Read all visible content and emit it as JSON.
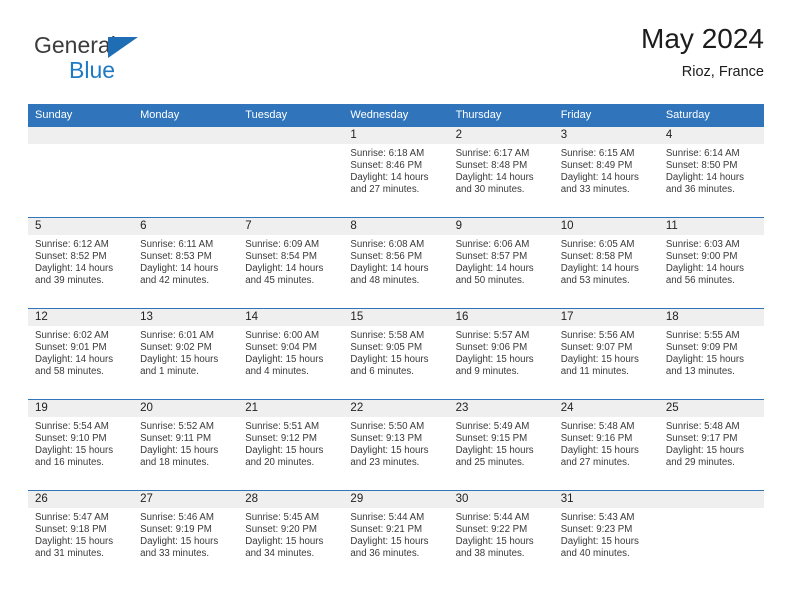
{
  "brand": {
    "name_part1": "General",
    "name_part2": "Blue",
    "accent_color": "#1f7ac4",
    "header_color": "#3075bc"
  },
  "header": {
    "title": "May 2024",
    "subtitle": "Rioz, France"
  },
  "weekday_headers": [
    "Sunday",
    "Monday",
    "Tuesday",
    "Wednesday",
    "Thursday",
    "Friday",
    "Saturday"
  ],
  "weeks": [
    [
      {
        "day": "",
        "sunrise": "",
        "sunset": "",
        "daylight_line1": "",
        "daylight_line2": ""
      },
      {
        "day": "",
        "sunrise": "",
        "sunset": "",
        "daylight_line1": "",
        "daylight_line2": ""
      },
      {
        "day": "",
        "sunrise": "",
        "sunset": "",
        "daylight_line1": "",
        "daylight_line2": ""
      },
      {
        "day": "1",
        "sunrise": "Sunrise: 6:18 AM",
        "sunset": "Sunset: 8:46 PM",
        "daylight_line1": "Daylight: 14 hours",
        "daylight_line2": "and 27 minutes."
      },
      {
        "day": "2",
        "sunrise": "Sunrise: 6:17 AM",
        "sunset": "Sunset: 8:48 PM",
        "daylight_line1": "Daylight: 14 hours",
        "daylight_line2": "and 30 minutes."
      },
      {
        "day": "3",
        "sunrise": "Sunrise: 6:15 AM",
        "sunset": "Sunset: 8:49 PM",
        "daylight_line1": "Daylight: 14 hours",
        "daylight_line2": "and 33 minutes."
      },
      {
        "day": "4",
        "sunrise": "Sunrise: 6:14 AM",
        "sunset": "Sunset: 8:50 PM",
        "daylight_line1": "Daylight: 14 hours",
        "daylight_line2": "and 36 minutes."
      }
    ],
    [
      {
        "day": "5",
        "sunrise": "Sunrise: 6:12 AM",
        "sunset": "Sunset: 8:52 PM",
        "daylight_line1": "Daylight: 14 hours",
        "daylight_line2": "and 39 minutes."
      },
      {
        "day": "6",
        "sunrise": "Sunrise: 6:11 AM",
        "sunset": "Sunset: 8:53 PM",
        "daylight_line1": "Daylight: 14 hours",
        "daylight_line2": "and 42 minutes."
      },
      {
        "day": "7",
        "sunrise": "Sunrise: 6:09 AM",
        "sunset": "Sunset: 8:54 PM",
        "daylight_line1": "Daylight: 14 hours",
        "daylight_line2": "and 45 minutes."
      },
      {
        "day": "8",
        "sunrise": "Sunrise: 6:08 AM",
        "sunset": "Sunset: 8:56 PM",
        "daylight_line1": "Daylight: 14 hours",
        "daylight_line2": "and 48 minutes."
      },
      {
        "day": "9",
        "sunrise": "Sunrise: 6:06 AM",
        "sunset": "Sunset: 8:57 PM",
        "daylight_line1": "Daylight: 14 hours",
        "daylight_line2": "and 50 minutes."
      },
      {
        "day": "10",
        "sunrise": "Sunrise: 6:05 AM",
        "sunset": "Sunset: 8:58 PM",
        "daylight_line1": "Daylight: 14 hours",
        "daylight_line2": "and 53 minutes."
      },
      {
        "day": "11",
        "sunrise": "Sunrise: 6:03 AM",
        "sunset": "Sunset: 9:00 PM",
        "daylight_line1": "Daylight: 14 hours",
        "daylight_line2": "and 56 minutes."
      }
    ],
    [
      {
        "day": "12",
        "sunrise": "Sunrise: 6:02 AM",
        "sunset": "Sunset: 9:01 PM",
        "daylight_line1": "Daylight: 14 hours",
        "daylight_line2": "and 58 minutes."
      },
      {
        "day": "13",
        "sunrise": "Sunrise: 6:01 AM",
        "sunset": "Sunset: 9:02 PM",
        "daylight_line1": "Daylight: 15 hours",
        "daylight_line2": "and 1 minute."
      },
      {
        "day": "14",
        "sunrise": "Sunrise: 6:00 AM",
        "sunset": "Sunset: 9:04 PM",
        "daylight_line1": "Daylight: 15 hours",
        "daylight_line2": "and 4 minutes."
      },
      {
        "day": "15",
        "sunrise": "Sunrise: 5:58 AM",
        "sunset": "Sunset: 9:05 PM",
        "daylight_line1": "Daylight: 15 hours",
        "daylight_line2": "and 6 minutes."
      },
      {
        "day": "16",
        "sunrise": "Sunrise: 5:57 AM",
        "sunset": "Sunset: 9:06 PM",
        "daylight_line1": "Daylight: 15 hours",
        "daylight_line2": "and 9 minutes."
      },
      {
        "day": "17",
        "sunrise": "Sunrise: 5:56 AM",
        "sunset": "Sunset: 9:07 PM",
        "daylight_line1": "Daylight: 15 hours",
        "daylight_line2": "and 11 minutes."
      },
      {
        "day": "18",
        "sunrise": "Sunrise: 5:55 AM",
        "sunset": "Sunset: 9:09 PM",
        "daylight_line1": "Daylight: 15 hours",
        "daylight_line2": "and 13 minutes."
      }
    ],
    [
      {
        "day": "19",
        "sunrise": "Sunrise: 5:54 AM",
        "sunset": "Sunset: 9:10 PM",
        "daylight_line1": "Daylight: 15 hours",
        "daylight_line2": "and 16 minutes."
      },
      {
        "day": "20",
        "sunrise": "Sunrise: 5:52 AM",
        "sunset": "Sunset: 9:11 PM",
        "daylight_line1": "Daylight: 15 hours",
        "daylight_line2": "and 18 minutes."
      },
      {
        "day": "21",
        "sunrise": "Sunrise: 5:51 AM",
        "sunset": "Sunset: 9:12 PM",
        "daylight_line1": "Daylight: 15 hours",
        "daylight_line2": "and 20 minutes."
      },
      {
        "day": "22",
        "sunrise": "Sunrise: 5:50 AM",
        "sunset": "Sunset: 9:13 PM",
        "daylight_line1": "Daylight: 15 hours",
        "daylight_line2": "and 23 minutes."
      },
      {
        "day": "23",
        "sunrise": "Sunrise: 5:49 AM",
        "sunset": "Sunset: 9:15 PM",
        "daylight_line1": "Daylight: 15 hours",
        "daylight_line2": "and 25 minutes."
      },
      {
        "day": "24",
        "sunrise": "Sunrise: 5:48 AM",
        "sunset": "Sunset: 9:16 PM",
        "daylight_line1": "Daylight: 15 hours",
        "daylight_line2": "and 27 minutes."
      },
      {
        "day": "25",
        "sunrise": "Sunrise: 5:48 AM",
        "sunset": "Sunset: 9:17 PM",
        "daylight_line1": "Daylight: 15 hours",
        "daylight_line2": "and 29 minutes."
      }
    ],
    [
      {
        "day": "26",
        "sunrise": "Sunrise: 5:47 AM",
        "sunset": "Sunset: 9:18 PM",
        "daylight_line1": "Daylight: 15 hours",
        "daylight_line2": "and 31 minutes."
      },
      {
        "day": "27",
        "sunrise": "Sunrise: 5:46 AM",
        "sunset": "Sunset: 9:19 PM",
        "daylight_line1": "Daylight: 15 hours",
        "daylight_line2": "and 33 minutes."
      },
      {
        "day": "28",
        "sunrise": "Sunrise: 5:45 AM",
        "sunset": "Sunset: 9:20 PM",
        "daylight_line1": "Daylight: 15 hours",
        "daylight_line2": "and 34 minutes."
      },
      {
        "day": "29",
        "sunrise": "Sunrise: 5:44 AM",
        "sunset": "Sunset: 9:21 PM",
        "daylight_line1": "Daylight: 15 hours",
        "daylight_line2": "and 36 minutes."
      },
      {
        "day": "30",
        "sunrise": "Sunrise: 5:44 AM",
        "sunset": "Sunset: 9:22 PM",
        "daylight_line1": "Daylight: 15 hours",
        "daylight_line2": "and 38 minutes."
      },
      {
        "day": "31",
        "sunrise": "Sunrise: 5:43 AM",
        "sunset": "Sunset: 9:23 PM",
        "daylight_line1": "Daylight: 15 hours",
        "daylight_line2": "and 40 minutes."
      },
      {
        "day": "",
        "sunrise": "",
        "sunset": "",
        "daylight_line1": "",
        "daylight_line2": ""
      }
    ]
  ]
}
